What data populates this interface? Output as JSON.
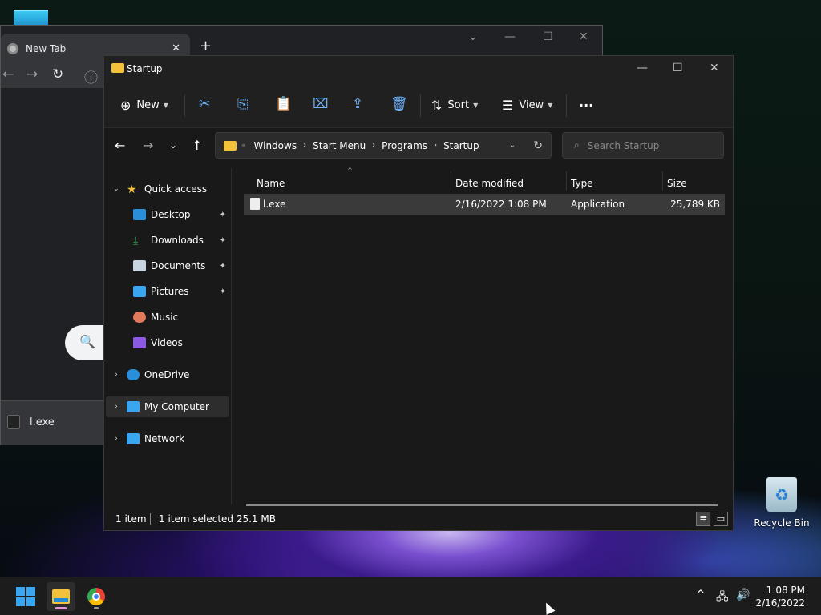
{
  "desktop": {
    "recycle_bin_label": "Recycle Bin"
  },
  "chrome": {
    "tab_title": "New Tab",
    "tab_close": "✕",
    "new_tab": "+",
    "minimize": "—",
    "restore": "☐",
    "close": "✕",
    "back": "←",
    "forward": "→",
    "reload": "↻",
    "info": "ⓘ",
    "chevron": "⌄",
    "search_icon_glyph": "🔍",
    "download_item": "l.exe"
  },
  "explorer": {
    "window_title": "Startup",
    "minimize": "—",
    "maximize": "☐",
    "close": "✕",
    "commands": {
      "new_label": "New",
      "sort_label": "Sort",
      "view_label": "View",
      "more": "···"
    },
    "tools": {
      "cut": "✂",
      "copy": "⎘",
      "paste": "📋",
      "rename": "⌧",
      "share": "⇪",
      "delete": "🗑"
    },
    "nav": {
      "back": "←",
      "forward": "→",
      "recent": "⌄",
      "up": "↑"
    },
    "address": {
      "overflow": "«",
      "crumbs": [
        "Windows",
        "Start Menu",
        "Programs",
        "Startup"
      ],
      "separator": "›",
      "dropdown": "⌄",
      "refresh": "↻"
    },
    "search_placeholder": "Search Startup",
    "sidebar": {
      "quick_access": "Quick access",
      "items": [
        {
          "label": "Desktop",
          "pinned": true
        },
        {
          "label": "Downloads",
          "pinned": true
        },
        {
          "label": "Documents",
          "pinned": true
        },
        {
          "label": "Pictures",
          "pinned": true
        },
        {
          "label": "Music",
          "pinned": false
        },
        {
          "label": "Videos",
          "pinned": false
        }
      ],
      "onedrive": "OneDrive",
      "my_computer": "My Computer",
      "network": "Network",
      "pin_glyph": "📌",
      "expand_glyph": "›",
      "collapse_glyph": "⌄"
    },
    "columns": {
      "name": "Name",
      "date_modified": "Date modified",
      "type": "Type",
      "size": "Size",
      "sort_caret": "^"
    },
    "files": [
      {
        "name": "l.exe",
        "date_modified": "2/16/2022 1:08 PM",
        "type": "Application",
        "size": "25,789 KB"
      }
    ],
    "status": {
      "item_count": "1 item",
      "selection": "1 item selected  25.1 MB"
    }
  },
  "taskbar": {
    "clock_time": "1:08 PM",
    "clock_date": "2/16/2022",
    "tray_chevron": "^",
    "network_glyph": "🖧",
    "volume_glyph": "🔊"
  },
  "colors": {
    "accent": "#3aa6f0",
    "folder": "#f3c13a",
    "explorer_bg": "#191919",
    "selected_row": "#3a3a3a"
  }
}
